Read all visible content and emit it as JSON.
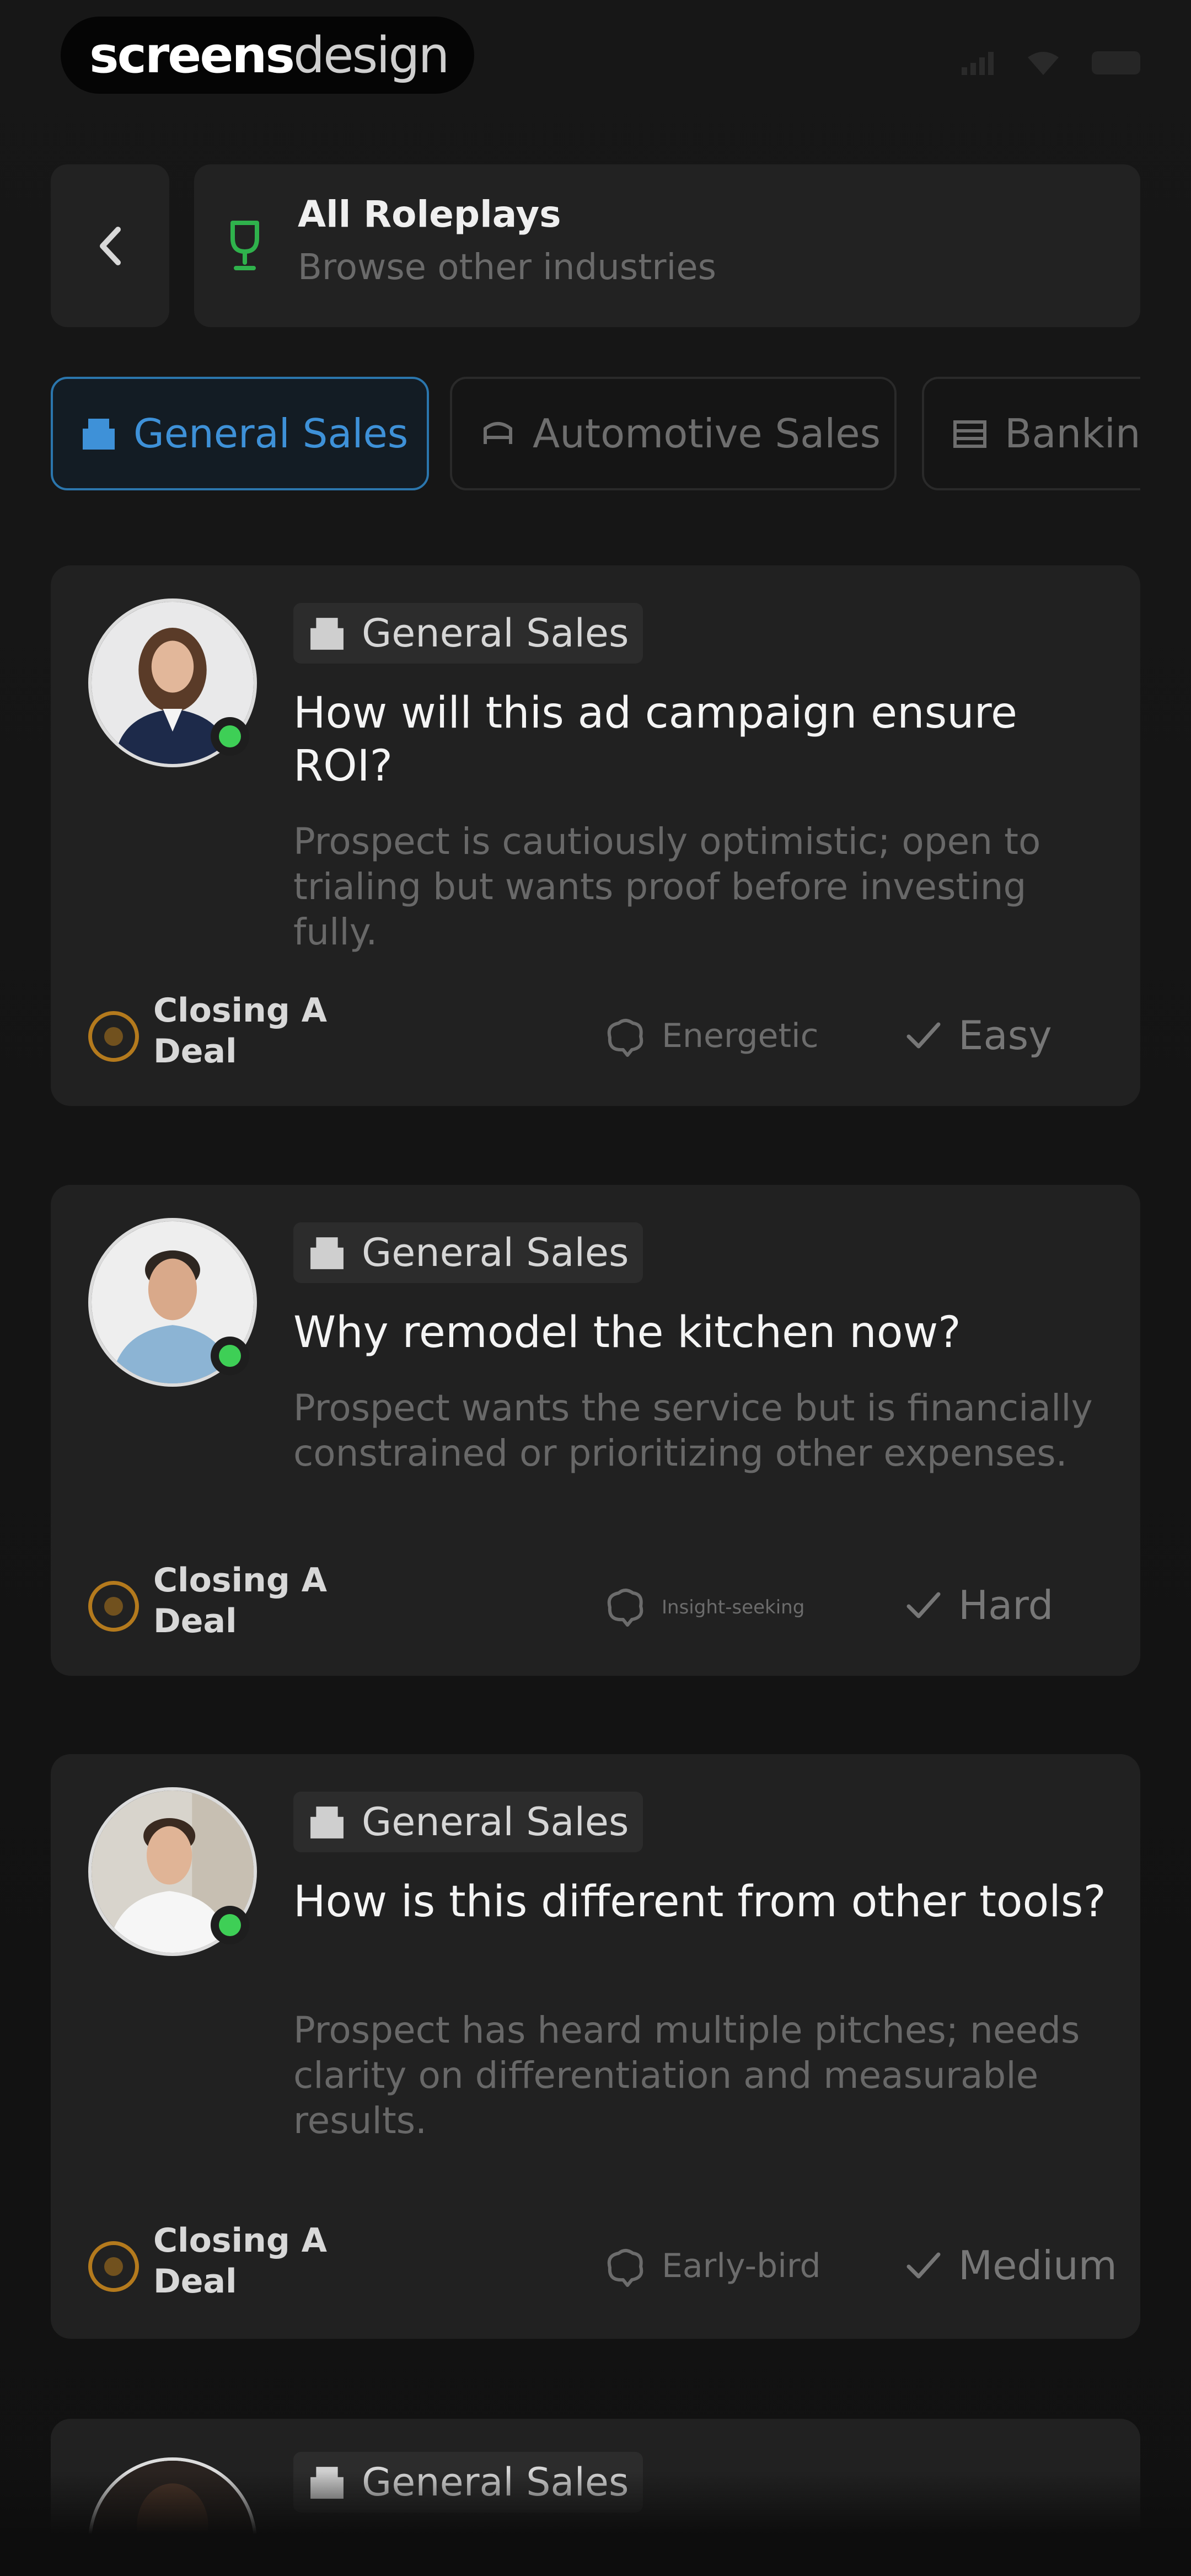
{
  "brand": {
    "part1": "screens",
    "part2": "design"
  },
  "header": {
    "back_icon": "chevron-left-icon",
    "title": "All Roleplays",
    "subtitle": "Browse other industries",
    "icon": "trophy-icon",
    "accent_color": "#2fb24c"
  },
  "filters": [
    {
      "label": "General Sales",
      "icon": "building-icon",
      "selected": true
    },
    {
      "label": "Automotive Sales",
      "icon": "car-icon",
      "selected": false
    },
    {
      "label": "Bankin",
      "icon": "bank-icon",
      "selected": false
    }
  ],
  "roleplays": [
    {
      "industry": "General Sales",
      "question": "How will this ad campaign ensure ROI?",
      "description": "Prospect is cautiously optimistic; open to trialing but wants proof before investing fully.",
      "goal": "Closing A Deal",
      "mood": "Energetic",
      "difficulty": "Easy",
      "online": true
    },
    {
      "industry": "General Sales",
      "question": "Why remodel the kitchen now?",
      "description": "Prospect wants the service but is financially constrained or prioritizing other expenses.",
      "goal": "Closing A Deal",
      "mood": "Insight-seeking",
      "difficulty": "Hard",
      "online": true
    },
    {
      "industry": "General Sales",
      "question": "How is this different from other tools?",
      "description": "Prospect has heard multiple pitches; needs clarity on differentiation and measurable results.",
      "goal": "Closing A Deal",
      "mood": "Early-bird",
      "difficulty": "Medium",
      "online": true
    },
    {
      "industry": "General Sales",
      "question": "",
      "description": "",
      "goal": "",
      "mood": "",
      "difficulty": "",
      "online": true
    }
  ],
  "colors": {
    "background": "#141414",
    "card": "#212121",
    "chip_active_border": "#2b76ad",
    "chip_active_text": "#3e91d8",
    "online": "#3ecf56",
    "goal_icon": "#b47a1d"
  }
}
